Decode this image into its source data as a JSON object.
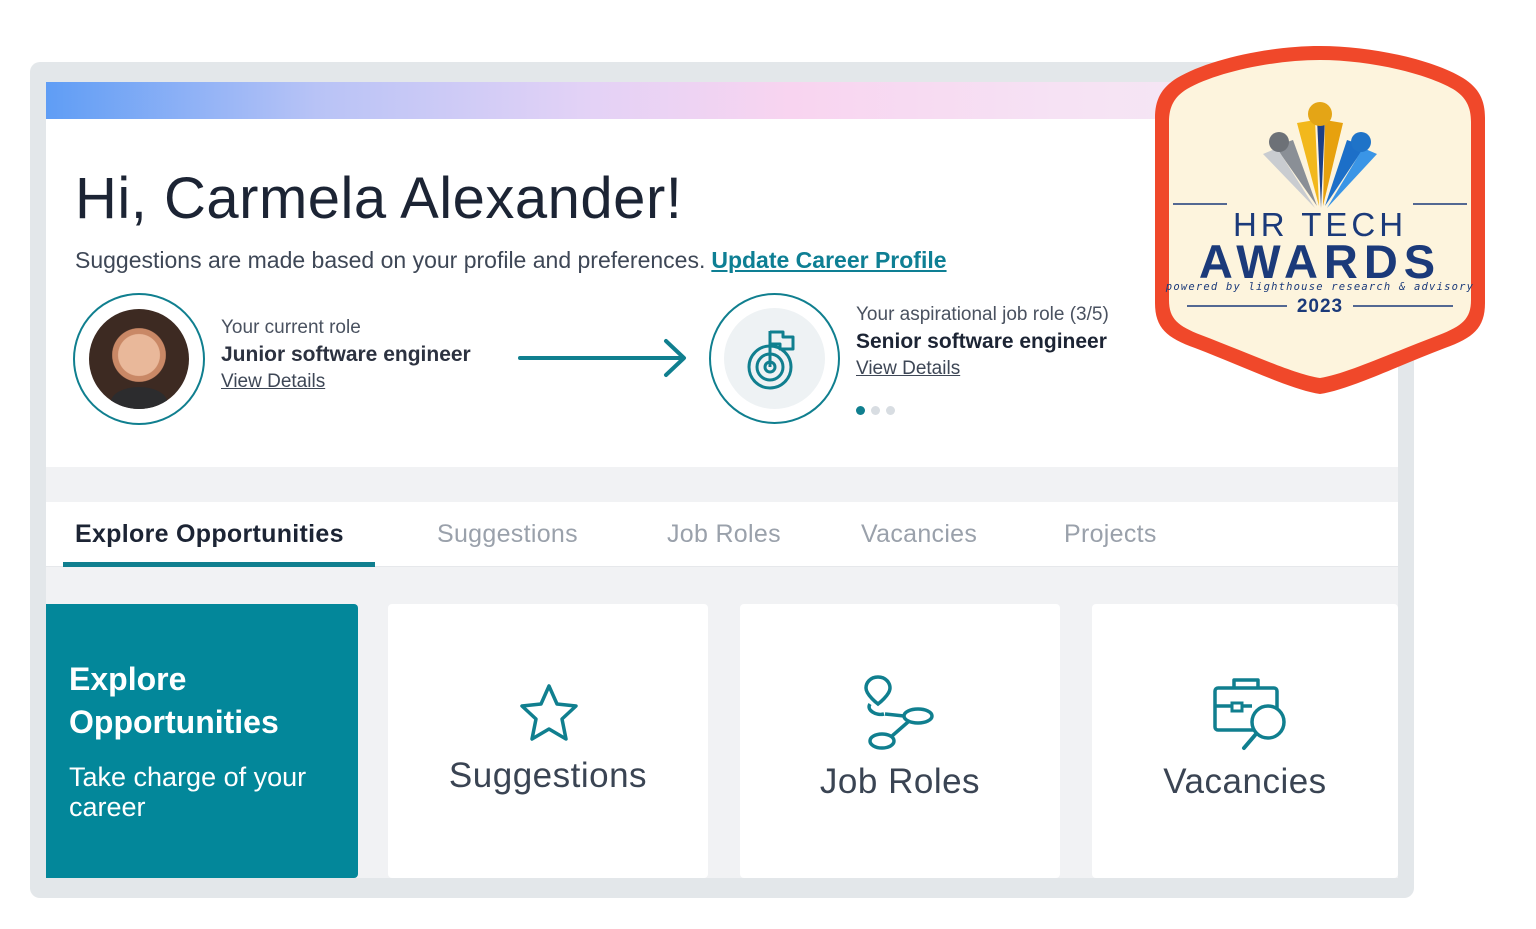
{
  "header": {
    "greeting": "Hi, Carmela Alexander!",
    "subtitle": "Suggestions are made based on your profile and preferences.",
    "update_link": "Update Career Profile"
  },
  "current_role": {
    "label": "Your current role",
    "name": "Junior software engineer",
    "link": "View Details"
  },
  "aspirational_role": {
    "label": "Your aspirational job role (3/5)",
    "name": "Senior software engineer",
    "link": "View Details",
    "carousel_total": 3,
    "carousel_active": 1
  },
  "tabs": [
    {
      "label": "Explore Opportunities",
      "active": true
    },
    {
      "label": "Suggestions",
      "active": false
    },
    {
      "label": "Job Roles",
      "active": false
    },
    {
      "label": "Vacancies",
      "active": false
    },
    {
      "label": "Projects",
      "active": false
    }
  ],
  "hero_card": {
    "title": "Explore Opportunities",
    "subtitle": "Take charge of your career"
  },
  "cards": [
    {
      "label": "Suggestions",
      "icon": "star-icon"
    },
    {
      "label": "Job Roles",
      "icon": "career-path-icon"
    },
    {
      "label": "Vacancies",
      "icon": "briefcase-search-icon"
    }
  ],
  "badge": {
    "line1": "HR TECH",
    "line2": "AWARDS",
    "powered_by": "powered by lighthouse research & advisory",
    "year": "2023"
  },
  "colors": {
    "accent": "#107f8f",
    "hero_bg": "#03879a",
    "link": "#0e7f94",
    "badge_border": "#f0482a",
    "badge_bg": "#fdf4dd",
    "badge_text": "#1b3a7a"
  }
}
